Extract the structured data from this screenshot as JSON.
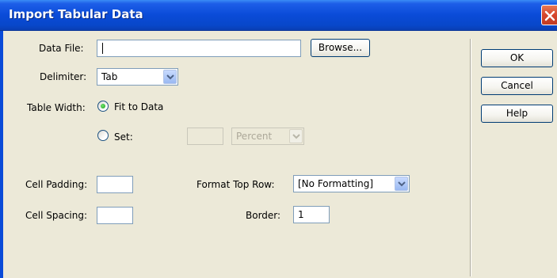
{
  "dialog": {
    "title": "Import Tabular Data"
  },
  "form": {
    "data_file_label": "Data File:",
    "data_file_value": "",
    "browse_label": "Browse...",
    "delimiter_label": "Delimiter:",
    "delimiter_value": "Tab",
    "table_width_label": "Table Width:",
    "fit_to_data_label": "Fit to Data",
    "set_label": "Set:",
    "set_value": "",
    "set_unit_value": "Percent",
    "cell_padding_label": "Cell Padding:",
    "cell_padding_value": "",
    "cell_spacing_label": "Cell Spacing:",
    "cell_spacing_value": "",
    "format_top_row_label": "Format Top Row:",
    "format_top_row_value": "[No Formatting]",
    "border_label": "Border:",
    "border_value": "1"
  },
  "buttons": {
    "ok": "OK",
    "cancel": "Cancel",
    "help": "Help"
  },
  "colors": {
    "titlebar": "#0a4bd8",
    "dialog_bg": "#ece9d8",
    "close_button": "#d5452b"
  }
}
